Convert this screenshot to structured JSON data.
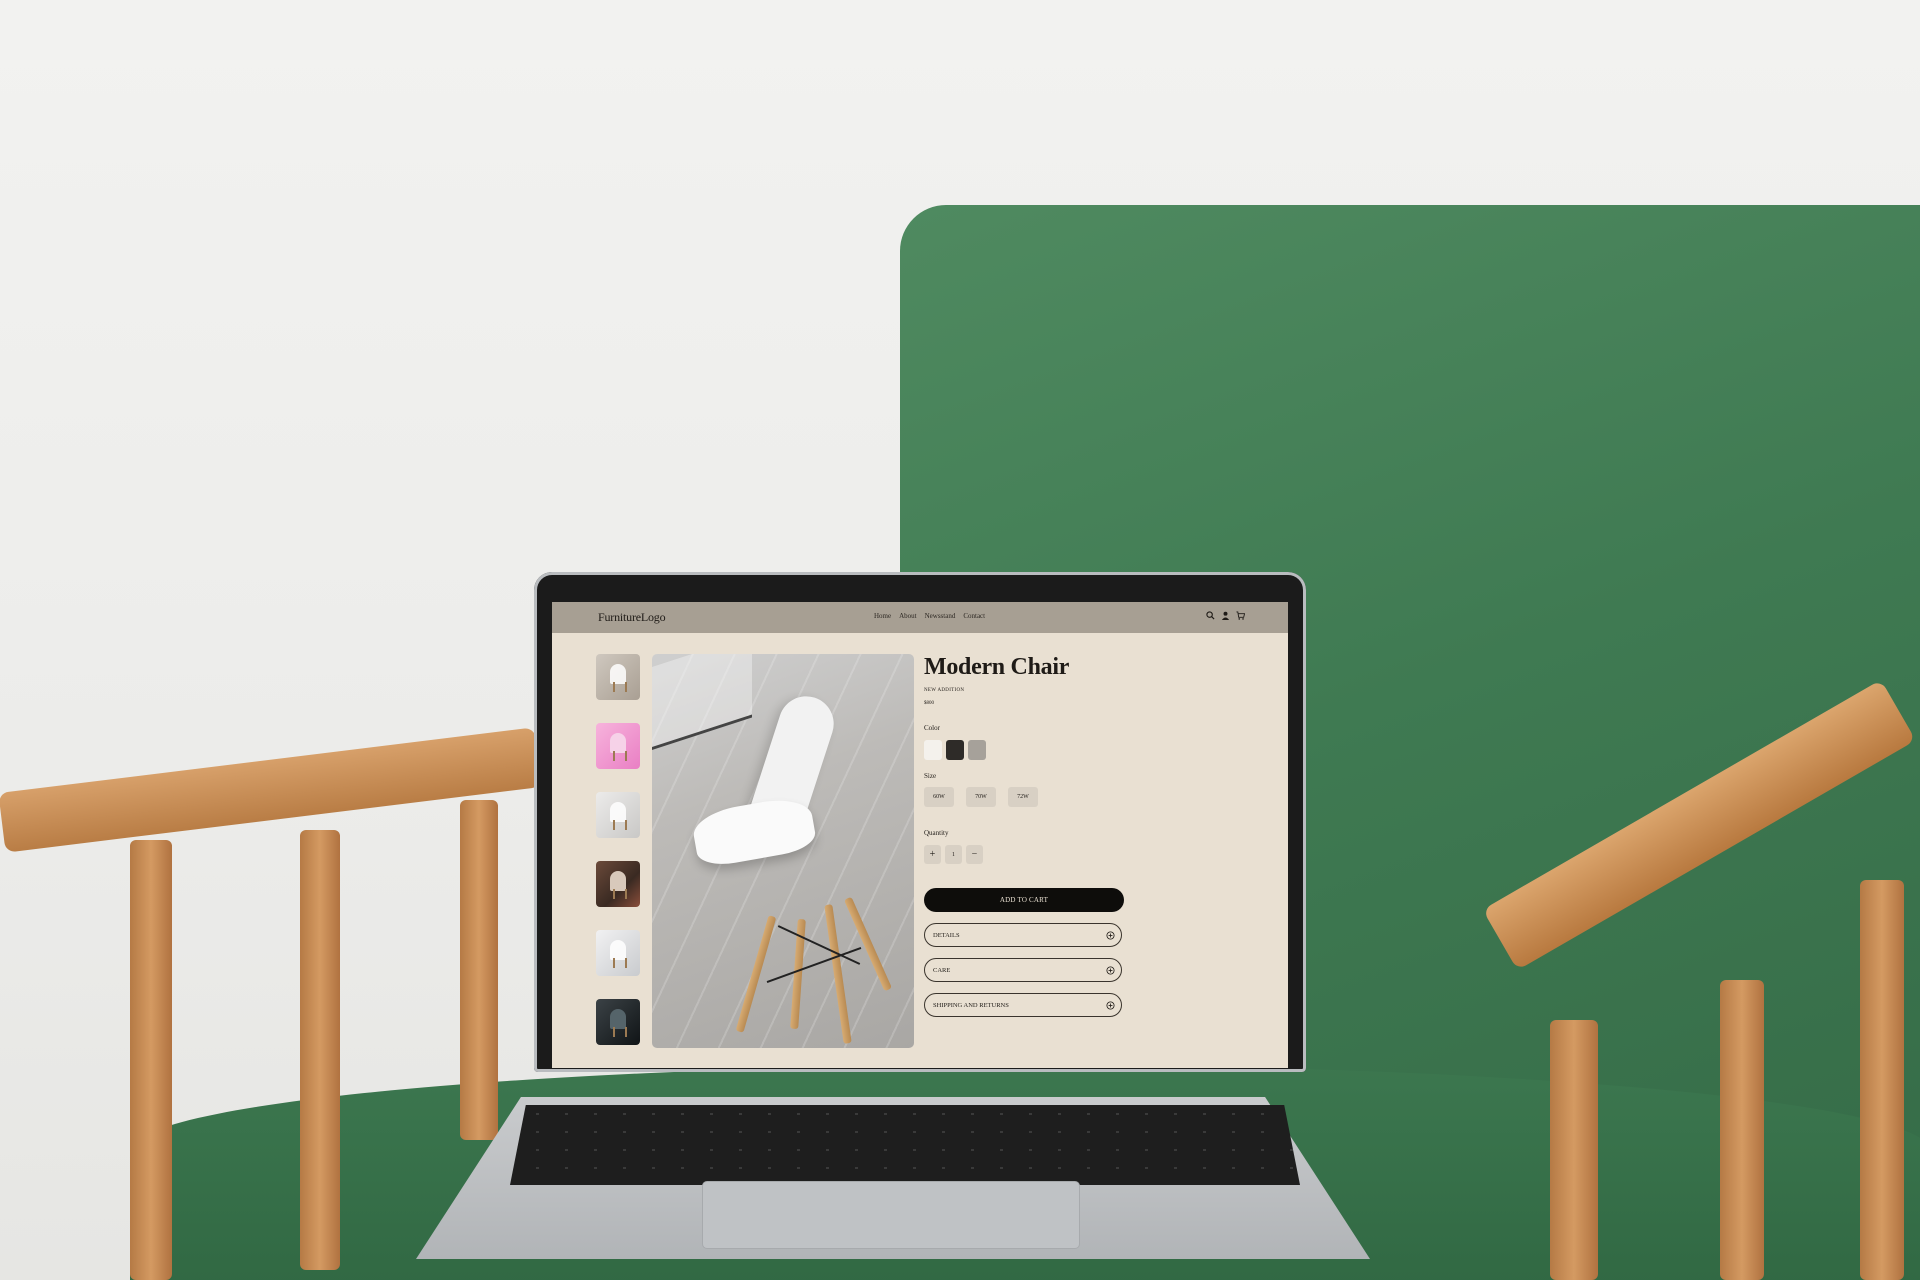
{
  "header": {
    "logo": "FurnitureLogo",
    "nav": [
      "Home",
      "About",
      "Newsstand",
      "Contact"
    ],
    "icons": [
      "search-icon",
      "user-icon",
      "cart-icon"
    ]
  },
  "gallery": {
    "thumbnails": [
      "thumb-white-chair",
      "thumb-pink-chair",
      "thumb-white-armchair",
      "thumb-room-chair",
      "thumb-white-chair-2",
      "thumb-dark-chair"
    ]
  },
  "product": {
    "title": "Modern Chair",
    "tag": "NEW ADDITION",
    "price": "$800",
    "color_label": "Color",
    "colors": [
      "#f4f1ec",
      "#2e2b28",
      "#a6a19a"
    ],
    "size_label": "Size",
    "sizes": [
      "60W",
      "70W",
      "72W"
    ],
    "quantity_label": "Quantity",
    "quantity": {
      "plus": "+",
      "value": "1",
      "minus": "−"
    },
    "add_to_cart": "ADD TO CART",
    "accordions": [
      "DETAILS",
      "CARE",
      "SHIPPING AND RETURNS"
    ]
  }
}
